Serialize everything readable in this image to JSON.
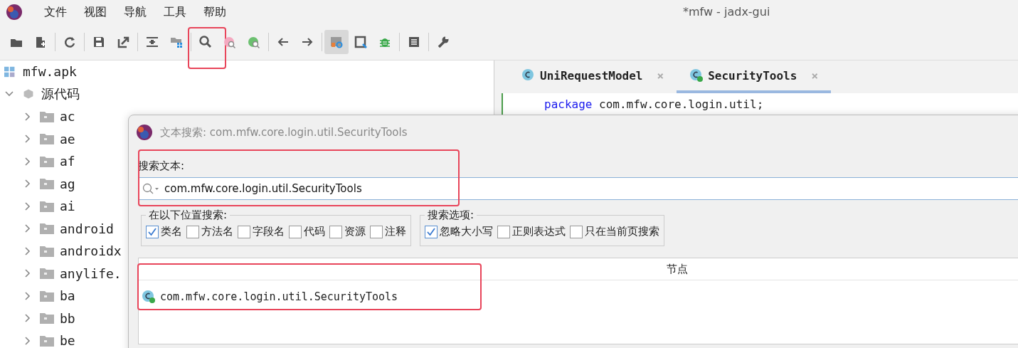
{
  "window": {
    "title": "*mfw - jadx-gui"
  },
  "menu": [
    "文件",
    "视图",
    "导航",
    "工具",
    "帮助"
  ],
  "toolbar": [
    {
      "kind": "open"
    },
    {
      "kind": "add"
    },
    {
      "kind": "sep"
    },
    {
      "kind": "sync"
    },
    {
      "kind": "sep"
    },
    {
      "kind": "save"
    },
    {
      "kind": "export"
    },
    {
      "kind": "sep"
    },
    {
      "kind": "wrap"
    },
    {
      "kind": "grid"
    },
    {
      "kind": "sep"
    },
    {
      "kind": "search",
      "annotated": true
    },
    {
      "kind": "search-pink"
    },
    {
      "kind": "search-green"
    },
    {
      "kind": "sep"
    },
    {
      "kind": "back"
    },
    {
      "kind": "forward"
    },
    {
      "kind": "sep"
    },
    {
      "kind": "settings",
      "selected": true
    },
    {
      "kind": "frame"
    },
    {
      "kind": "bug"
    },
    {
      "kind": "sep"
    },
    {
      "kind": "log"
    },
    {
      "kind": "sep"
    },
    {
      "kind": "wrench"
    }
  ],
  "tree": {
    "label": "mfw.apk",
    "children": [
      {
        "label": "源代码",
        "expanded": true,
        "children": [
          {
            "label": "ac",
            "expanded": false
          },
          {
            "label": "ae",
            "expanded": false
          },
          {
            "label": "af",
            "expanded": false
          },
          {
            "label": "ag",
            "expanded": false
          },
          {
            "label": "ai",
            "expanded": false
          },
          {
            "label": "android",
            "expanded": false
          },
          {
            "label": "androidx",
            "expanded": false
          },
          {
            "label": "anylife.",
            "expanded": false
          },
          {
            "label": "ba",
            "expanded": false
          },
          {
            "label": "bb",
            "expanded": false
          },
          {
            "label": "be",
            "expanded": false
          }
        ]
      }
    ]
  },
  "editor": {
    "tabs": [
      {
        "label": "UniRequestModel",
        "close": "×",
        "selected": false,
        "public": false
      },
      {
        "label": "SecurityTools",
        "close": "×",
        "selected": true,
        "public": true
      }
    ],
    "code": {
      "keyword": "package",
      "text": "com.mfw.core.login.util;"
    }
  },
  "dialog": {
    "title": "文本搜索: com.mfw.core.login.util.SecurityTools",
    "search_label": "搜索文本:",
    "search_value": "com.mfw.core.login.util.SecurityTools",
    "search_annotated": true,
    "groups": [
      {
        "title": "在以下位置搜索:",
        "options": [
          {
            "label": "类名",
            "checked": true
          },
          {
            "label": "方法名",
            "checked": false
          },
          {
            "label": "字段名",
            "checked": false
          },
          {
            "label": "代码",
            "checked": false
          },
          {
            "label": "资源",
            "checked": false
          },
          {
            "label": "注释",
            "checked": false
          }
        ]
      },
      {
        "title": "搜索选项:",
        "options": [
          {
            "label": "忽略大小写",
            "checked": true
          },
          {
            "label": "正则表达式",
            "checked": false
          },
          {
            "label": "只在当前页搜索",
            "checked": false
          }
        ]
      }
    ],
    "results": {
      "columns": [
        "节点"
      ],
      "rows": [
        {
          "text": "com.mfw.core.login.util.SecurityTools",
          "annotated": true
        }
      ]
    }
  }
}
